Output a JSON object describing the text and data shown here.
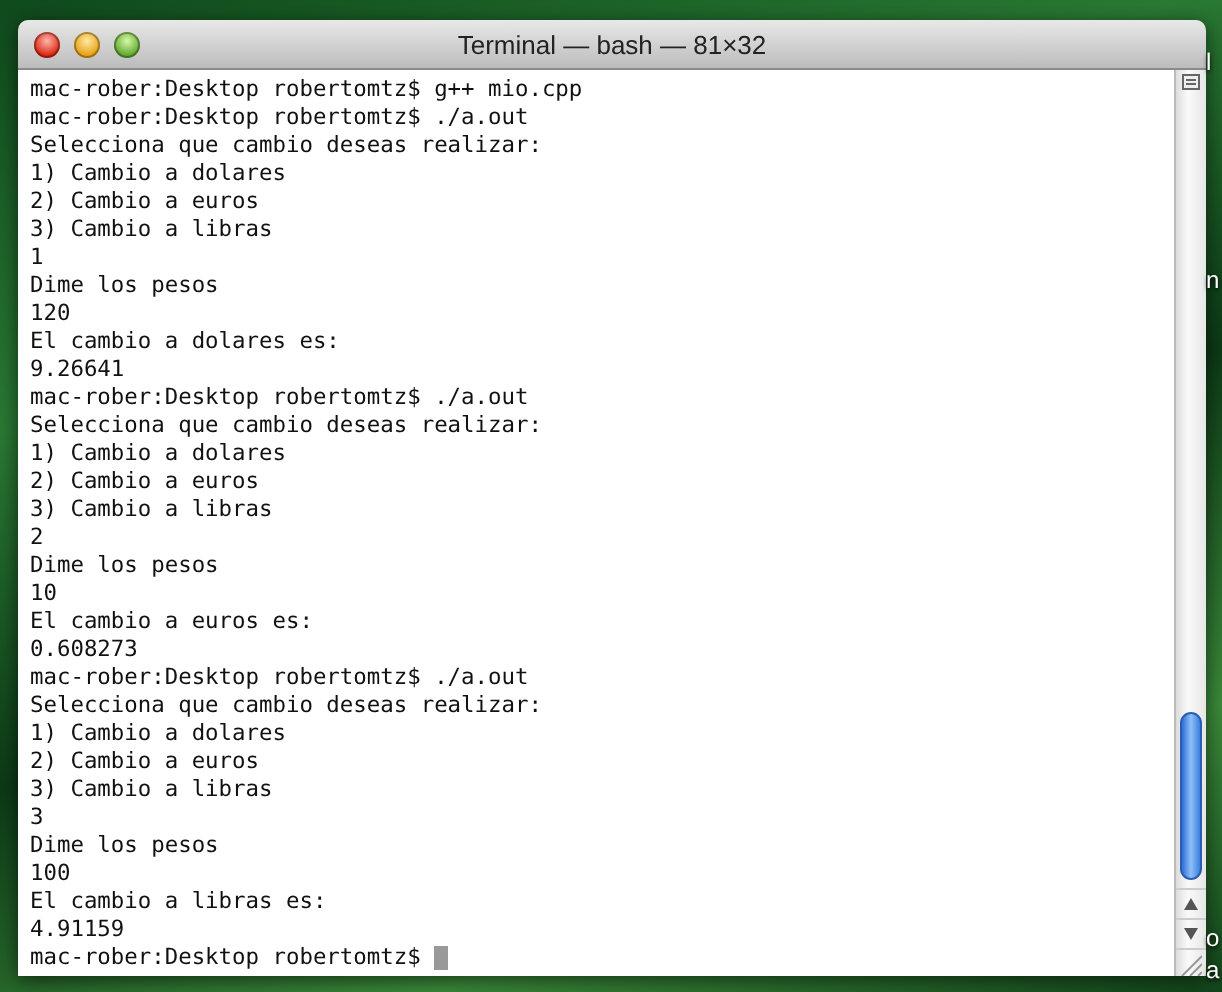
{
  "window": {
    "title": "Terminal — bash — 81×32"
  },
  "lines": [
    "mac-rober:Desktop robertomtz$ g++ mio.cpp",
    "mac-rober:Desktop robertomtz$ ./a.out",
    "Selecciona que cambio deseas realizar:",
    "1) Cambio a dolares",
    "2) Cambio a euros",
    "3) Cambio a libras",
    "1",
    "Dime los pesos",
    "120",
    "El cambio a dolares es:",
    "9.26641",
    "mac-rober:Desktop robertomtz$ ./a.out",
    "Selecciona que cambio deseas realizar:",
    "1) Cambio a dolares",
    "2) Cambio a euros",
    "3) Cambio a libras",
    "2",
    "Dime los pesos",
    "10",
    "El cambio a euros es:",
    "0.608273",
    "mac-rober:Desktop robertomtz$ ./a.out",
    "Selecciona que cambio deseas realizar:",
    "1) Cambio a dolares",
    "2) Cambio a euros",
    "3) Cambio a libras",
    "3",
    "Dime los pesos",
    "100",
    "El cambio a libras es:",
    "4.91159"
  ],
  "prompt": "mac-rober:Desktop robertomtz$",
  "desktop_labels": [
    "l",
    "n",
    "o",
    "a"
  ]
}
